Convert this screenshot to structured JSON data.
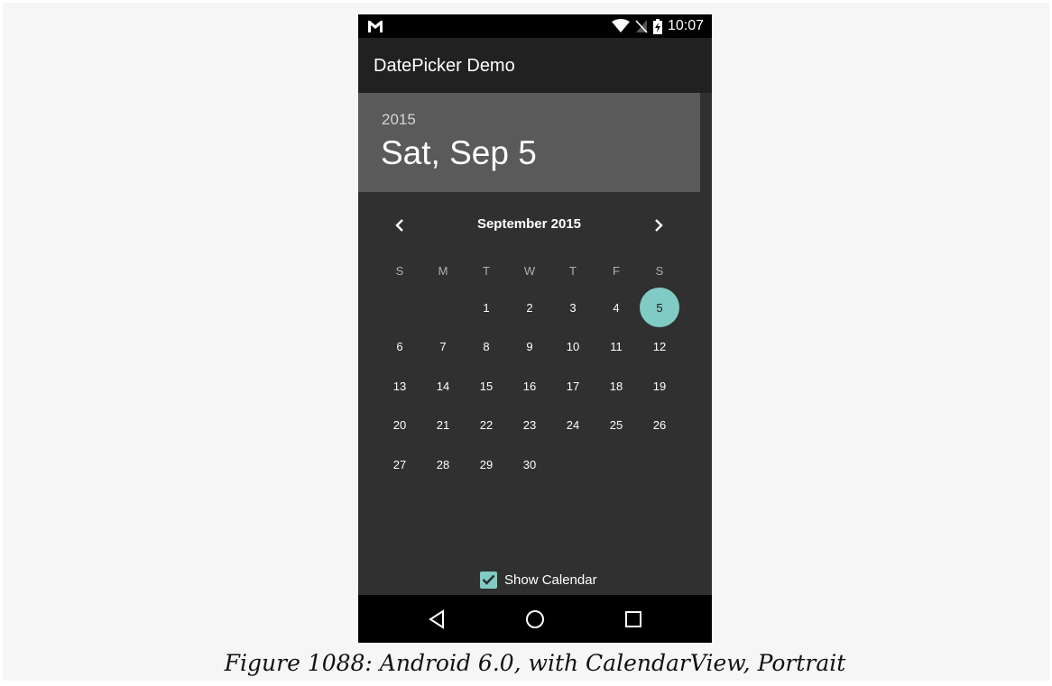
{
  "status_bar": {
    "time": "10:07",
    "left_icon": "gmail-icon",
    "icons": [
      "wifi-icon",
      "no-signal-icon",
      "battery-charging-icon"
    ]
  },
  "app_bar": {
    "title": "DatePicker Demo"
  },
  "date_header": {
    "year": "2015",
    "selected_date": "Sat, Sep 5"
  },
  "calendar": {
    "month_label": "September 2015",
    "weekday_labels": [
      "S",
      "M",
      "T",
      "W",
      "T",
      "F",
      "S"
    ],
    "weeks": [
      [
        "",
        "",
        "1",
        "2",
        "3",
        "4",
        "5"
      ],
      [
        "6",
        "7",
        "8",
        "9",
        "10",
        "11",
        "12"
      ],
      [
        "13",
        "14",
        "15",
        "16",
        "17",
        "18",
        "19"
      ],
      [
        "20",
        "21",
        "22",
        "23",
        "24",
        "25",
        "26"
      ],
      [
        "27",
        "28",
        "29",
        "30",
        "",
        "",
        ""
      ]
    ],
    "selected_day": "5",
    "accent_color": "#80cbc4"
  },
  "show_calendar": {
    "label": "Show Calendar",
    "checked": true
  },
  "nav_bar": {
    "buttons": [
      "back-icon",
      "home-icon",
      "recents-icon"
    ]
  },
  "caption": "Figure 1088: Android 6.0, with CalendarView, Portrait"
}
